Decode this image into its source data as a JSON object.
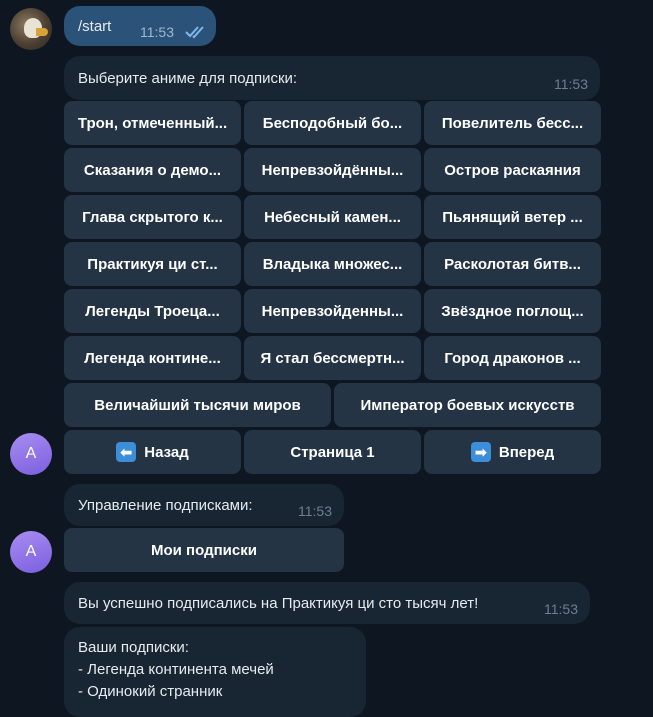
{
  "user_message": {
    "text": "/start",
    "time": "11:53"
  },
  "anime_menu": {
    "prompt": "Выберите аниме для подписки:",
    "time": "11:53",
    "rows": [
      [
        "Трон, отмеченный...",
        "Бесподобный бо...",
        "Повелитель бесс..."
      ],
      [
        "Сказания о демо...",
        "Непревзойдённы...",
        "Остров раскаяния"
      ],
      [
        "Глава скрытого к...",
        "Небесный камен...",
        "Пьянящий ветер ..."
      ],
      [
        "Практикуя ци ст...",
        "Владыка множес...",
        "Расколотая битв..."
      ],
      [
        "Легенды Троеца...",
        "Непревзойденны...",
        "Звёздное поглощ..."
      ],
      [
        "Легенда контине...",
        "Я стал бессмертн...",
        "Город драконов ..."
      ]
    ],
    "wide_row": [
      "Величайший тысячи миров",
      "Император боевых искусств"
    ],
    "nav": {
      "back_label": "Назад",
      "page_label": "Страница 1",
      "forward_label": "Вперед"
    }
  },
  "bot_avatar_letter": "A",
  "subscriptions_menu": {
    "text": "Управление подписками:",
    "time": "11:53",
    "button": "Мои подписки"
  },
  "success_message": {
    "text": "Вы успешно подписались на Практикуя ци сто тысяч лет!",
    "time": "11:53"
  },
  "subscriptions_list": {
    "title": "Ваши подписки:",
    "items": [
      "- Легенда континента мечей",
      "- Одинокий странник"
    ]
  },
  "colors": {
    "background": "#0e1621",
    "bubble_in": "#182533",
    "bubble_out": "#2b5278",
    "button": "#243445",
    "avatar_bot": "#8b6fe8"
  }
}
